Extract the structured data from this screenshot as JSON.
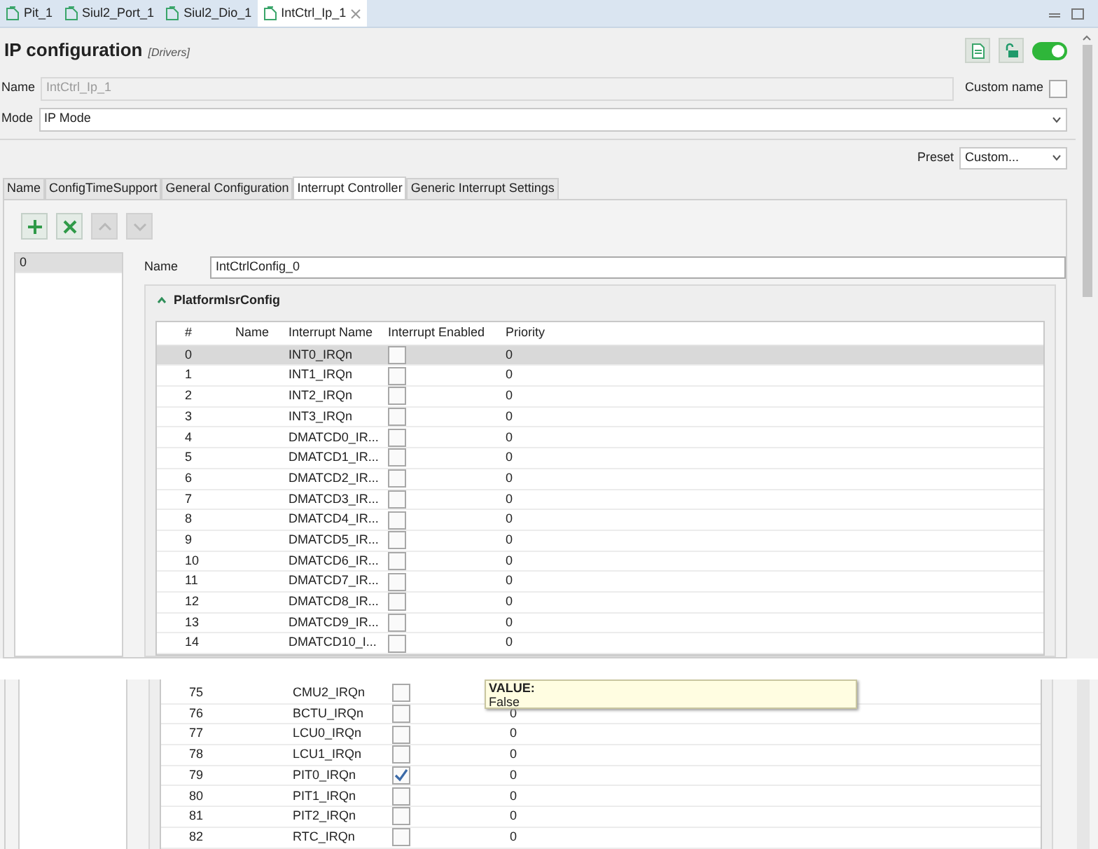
{
  "editor_tabs": [
    {
      "label": "Pit_1",
      "selected": false
    },
    {
      "label": "Siul2_Port_1",
      "selected": false
    },
    {
      "label": "Siul2_Dio_1",
      "selected": false
    },
    {
      "label": "IntCtrl_Ip_1",
      "selected": true
    }
  ],
  "header": {
    "title": "IP configuration",
    "subtitle": "[Drivers]",
    "toggle_on": true
  },
  "name_field": {
    "label": "Name",
    "value": "IntCtrl_Ip_1",
    "disabled": true
  },
  "custom_name": {
    "label": "Custom name",
    "checked": false
  },
  "mode": {
    "label": "Mode",
    "value": "IP Mode"
  },
  "preset": {
    "label": "Preset",
    "value": "Custom..."
  },
  "config_tabs": [
    {
      "label": "Name",
      "selected": false
    },
    {
      "label": "ConfigTimeSupport",
      "selected": false
    },
    {
      "label": "General Configuration",
      "selected": false
    },
    {
      "label": "Interrupt Controller",
      "selected": true
    },
    {
      "label": "Generic Interrupt Settings",
      "selected": false
    }
  ],
  "toolbar": [
    {
      "kind": "add",
      "disabled": false
    },
    {
      "kind": "delete",
      "disabled": false
    },
    {
      "kind": "up",
      "disabled": true
    },
    {
      "kind": "down",
      "disabled": true
    }
  ],
  "config_list": [
    {
      "label": "0",
      "selected": true
    }
  ],
  "config_name": {
    "label": "Name",
    "value": "IntCtrlConfig_0"
  },
  "section": {
    "title": "PlatformIsrConfig",
    "expanded": true
  },
  "table": {
    "columns": [
      "#",
      "Name",
      "Interrupt Name",
      "Interrupt Enabled",
      "Priority"
    ],
    "row_groups": [
      [
        {
          "index": "0",
          "interrupt_name": "INT0_IRQn",
          "enabled": false,
          "priority": "0",
          "selected": true
        },
        {
          "index": "1",
          "interrupt_name": "INT1_IRQn",
          "enabled": false,
          "priority": "0",
          "selected": false
        },
        {
          "index": "2",
          "interrupt_name": "INT2_IRQn",
          "enabled": false,
          "priority": "0",
          "selected": false
        },
        {
          "index": "3",
          "interrupt_name": "INT3_IRQn",
          "enabled": false,
          "priority": "0",
          "selected": false
        },
        {
          "index": "4",
          "interrupt_name": "DMATCD0_IR...",
          "enabled": false,
          "priority": "0",
          "selected": false
        },
        {
          "index": "5",
          "interrupt_name": "DMATCD1_IR...",
          "enabled": false,
          "priority": "0",
          "selected": false
        },
        {
          "index": "6",
          "interrupt_name": "DMATCD2_IR...",
          "enabled": false,
          "priority": "0",
          "selected": false
        },
        {
          "index": "7",
          "interrupt_name": "DMATCD3_IR...",
          "enabled": false,
          "priority": "0",
          "selected": false
        },
        {
          "index": "8",
          "interrupt_name": "DMATCD4_IR...",
          "enabled": false,
          "priority": "0",
          "selected": false
        },
        {
          "index": "9",
          "interrupt_name": "DMATCD5_IR...",
          "enabled": false,
          "priority": "0",
          "selected": false
        },
        {
          "index": "10",
          "interrupt_name": "DMATCD6_IR...",
          "enabled": false,
          "priority": "0",
          "selected": false
        },
        {
          "index": "11",
          "interrupt_name": "DMATCD7_IR...",
          "enabled": false,
          "priority": "0",
          "selected": false
        },
        {
          "index": "12",
          "interrupt_name": "DMATCD8_IR...",
          "enabled": false,
          "priority": "0",
          "selected": false
        },
        {
          "index": "13",
          "interrupt_name": "DMATCD9_IR...",
          "enabled": false,
          "priority": "0",
          "selected": false
        },
        {
          "index": "14",
          "interrupt_name": "DMATCD10_I...",
          "enabled": false,
          "priority": "0",
          "selected": false
        }
      ],
      [
        {
          "index": "75",
          "interrupt_name": "CMU2_IRQn",
          "enabled": false,
          "selected": false
        },
        {
          "index": "76",
          "interrupt_name": "BCTU_IRQn",
          "enabled": false,
          "priority": "0",
          "selected": false
        },
        {
          "index": "77",
          "interrupt_name": "LCU0_IRQn",
          "enabled": false,
          "priority": "0",
          "selected": false
        },
        {
          "index": "78",
          "interrupt_name": "LCU1_IRQn",
          "enabled": false,
          "priority": "0",
          "selected": false
        },
        {
          "index": "79",
          "interrupt_name": "PIT0_IRQn",
          "enabled": true,
          "priority": "0",
          "selected": false
        },
        {
          "index": "80",
          "interrupt_name": "PIT1_IRQn",
          "enabled": false,
          "priority": "0",
          "selected": false
        },
        {
          "index": "81",
          "interrupt_name": "PIT2_IRQn",
          "enabled": false,
          "priority": "0",
          "selected": false
        },
        {
          "index": "82",
          "interrupt_name": "RTC_IRQn",
          "enabled": false,
          "priority": "0",
          "selected": false
        }
      ]
    ]
  },
  "tooltip": {
    "heading": "VALUE:",
    "text": "False"
  }
}
